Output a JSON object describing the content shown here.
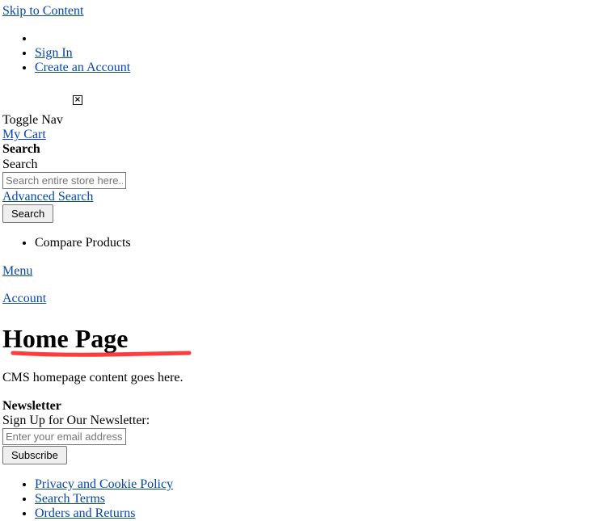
{
  "skip_link": "Skip to Content",
  "header_links": [
    "",
    "Sign In",
    "Create an Account"
  ],
  "logo_icon": "broken-image-icon",
  "toggle_nav": "Toggle Nav",
  "my_cart": "My Cart",
  "search": {
    "heading": "Search",
    "label": "Search",
    "placeholder": "Search entire store here...",
    "advanced": "Advanced Search",
    "button": "Search"
  },
  "compare": "Compare Products",
  "menu_tab": "Menu",
  "account_tab": "Account",
  "page_title": "Home Page",
  "annotation_color": "#ff3b3b",
  "content": "CMS homepage content goes here.",
  "newsletter": {
    "heading": "Newsletter",
    "label": "Sign Up for Our Newsletter:",
    "placeholder": "Enter your email address",
    "button": "Subscribe"
  },
  "footer_links": [
    "Privacy and Cookie Policy",
    "Search Terms",
    "Orders and Returns"
  ]
}
